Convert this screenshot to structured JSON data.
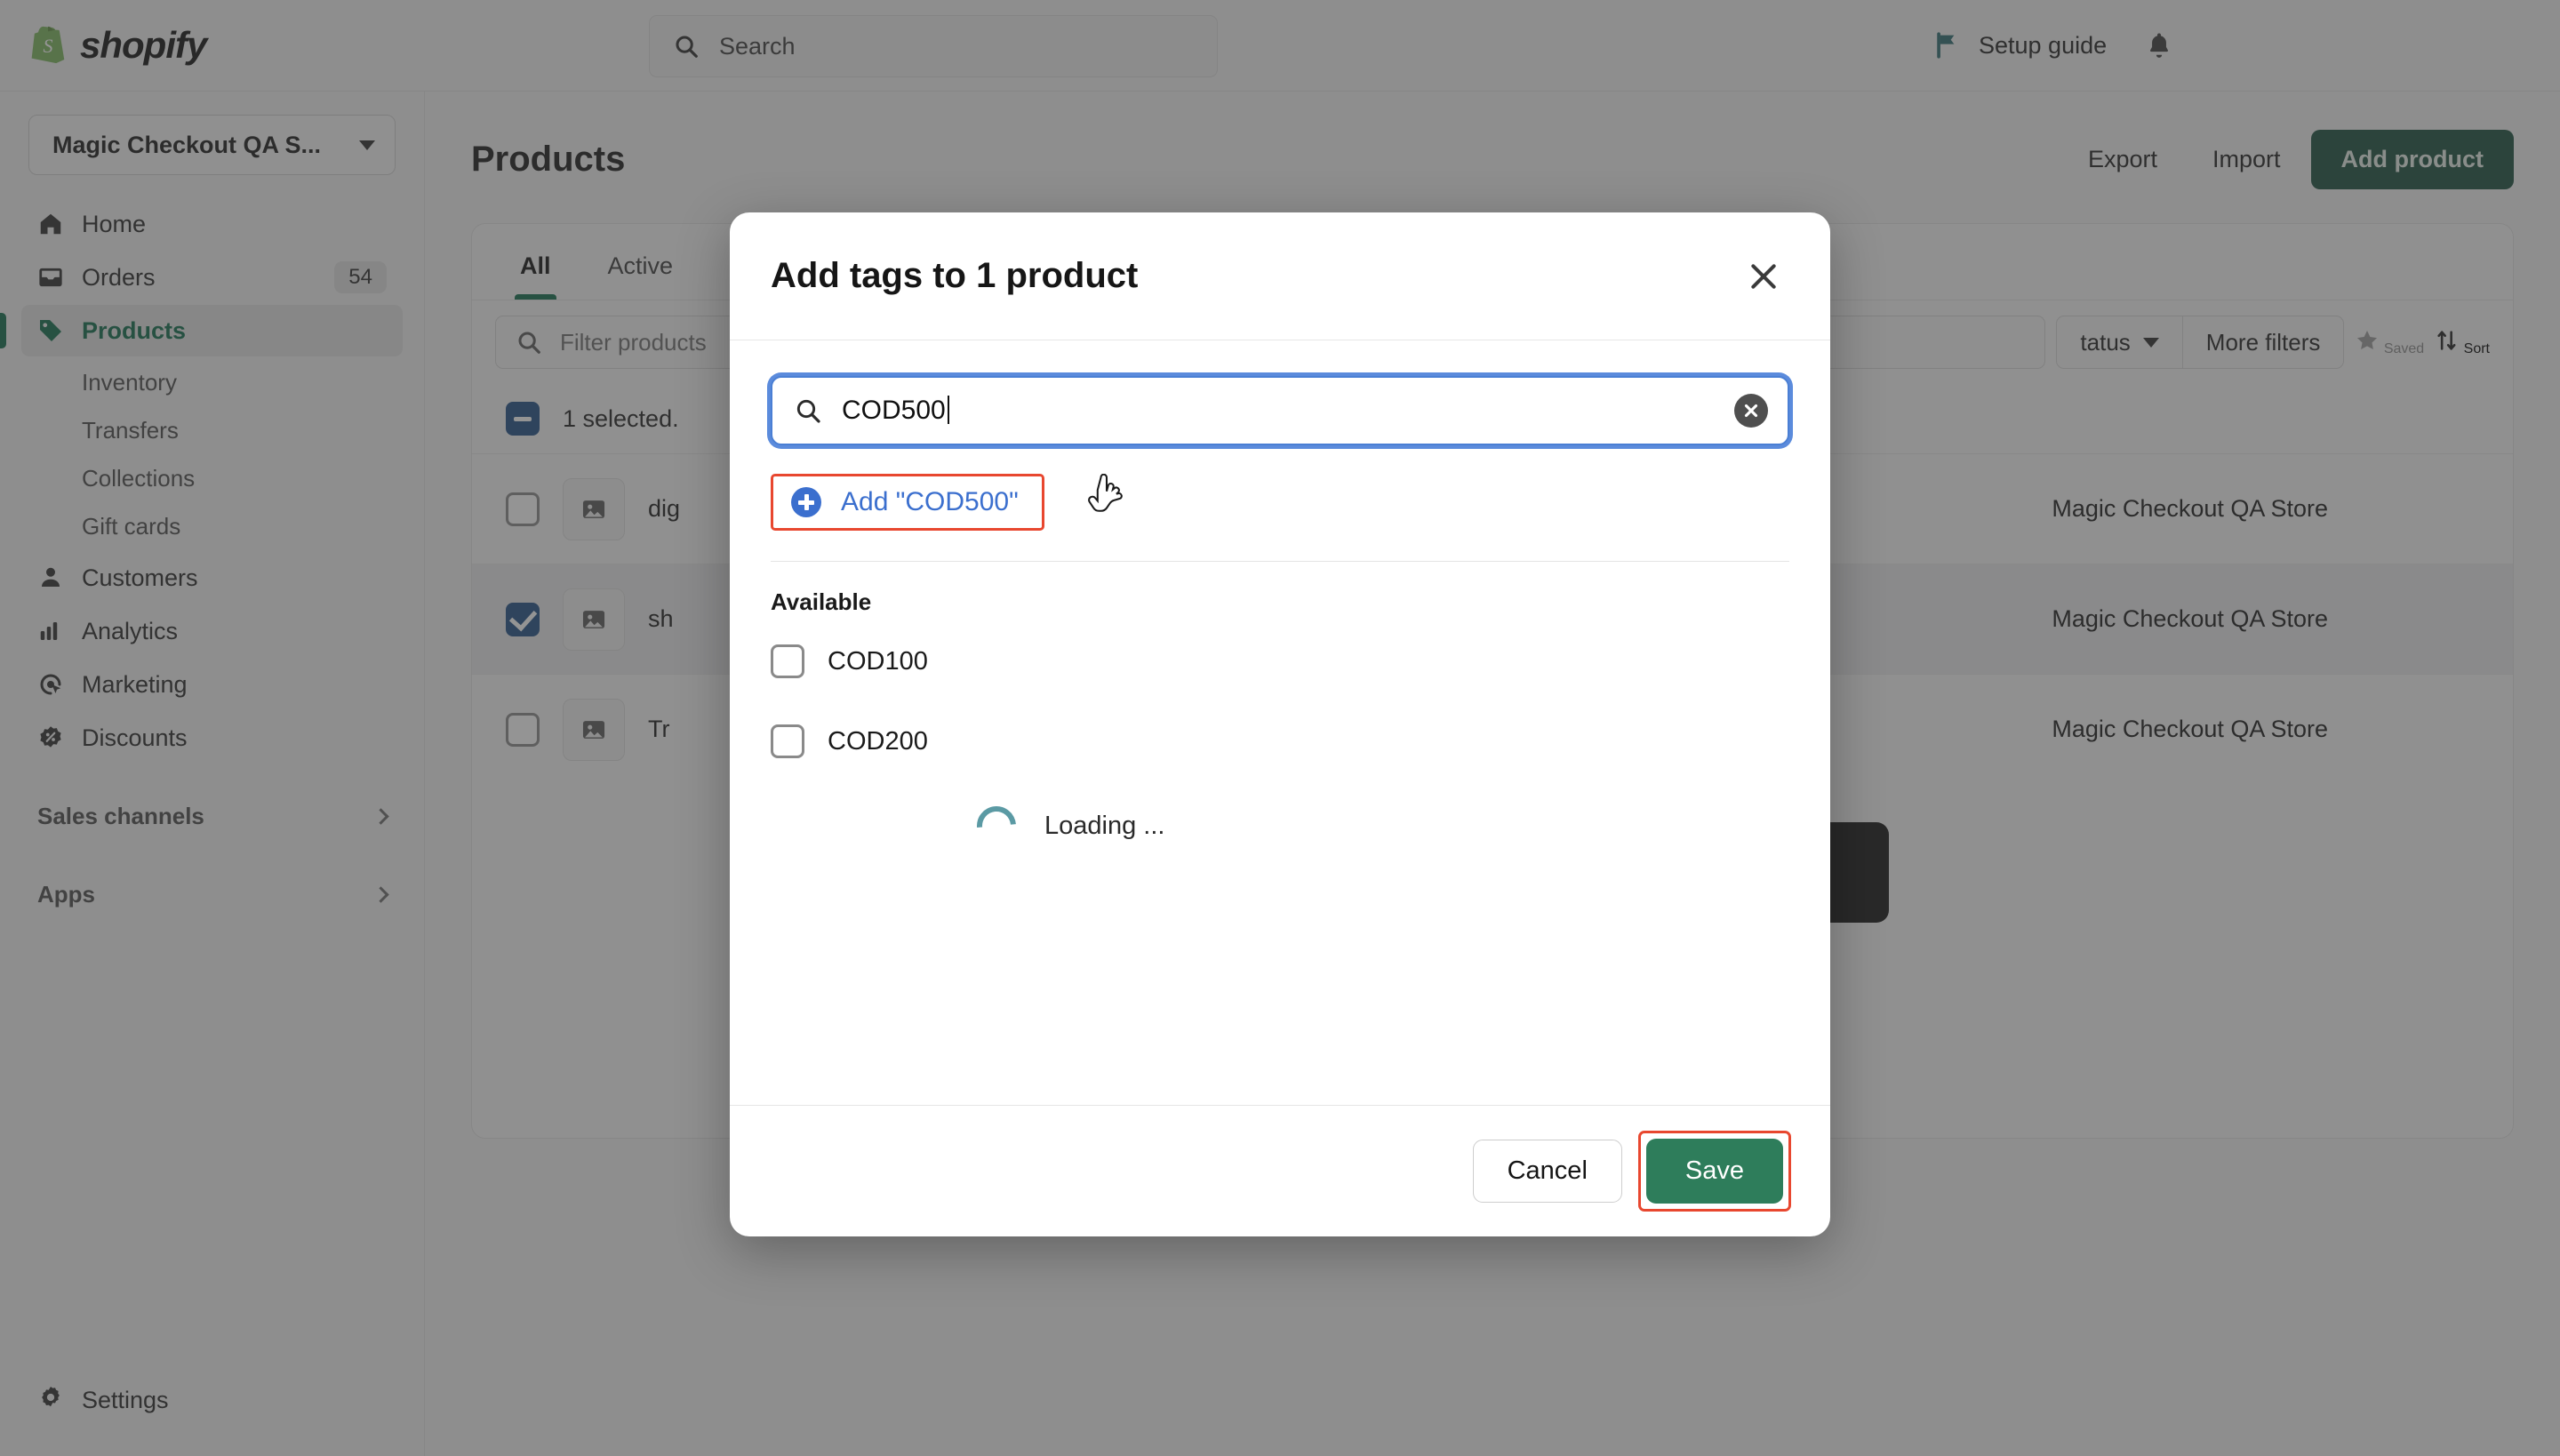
{
  "topbar": {
    "brand": "shopify",
    "search_placeholder": "Search",
    "setup_guide_label": "Setup guide",
    "flag_icon": "flag-icon",
    "bell_icon": "bell-icon",
    "search_icon": "search-icon"
  },
  "sidebar": {
    "store_name": "Magic Checkout QA S...",
    "items": [
      {
        "label": "Home",
        "icon": "home-icon",
        "badge": ""
      },
      {
        "label": "Orders",
        "icon": "orders-inbox-icon",
        "badge": "54"
      },
      {
        "label": "Products",
        "icon": "tag-icon",
        "badge": "",
        "active": true
      },
      {
        "label": "Customers",
        "icon": "person-icon",
        "badge": ""
      },
      {
        "label": "Analytics",
        "icon": "bar-chart-icon",
        "badge": ""
      },
      {
        "label": "Marketing",
        "icon": "marketing-target-icon",
        "badge": ""
      },
      {
        "label": "Discounts",
        "icon": "discount-badge-icon",
        "badge": ""
      }
    ],
    "sub_items": [
      "Inventory",
      "Transfers",
      "Collections",
      "Gift cards"
    ],
    "groups": [
      {
        "label": "Sales channels"
      },
      {
        "label": "Apps"
      }
    ],
    "settings_label": "Settings",
    "settings_icon": "gear-icon"
  },
  "page": {
    "title": "Products",
    "export_label": "Export",
    "import_label": "Import",
    "add_product_label": "Add product"
  },
  "tabs": [
    {
      "label": "All",
      "selected": true
    },
    {
      "label": "Active",
      "selected": false
    }
  ],
  "filters": {
    "placeholder": "Filter products",
    "status_label": "tatus",
    "more_filters_label": "More filters",
    "saved_label": "Saved",
    "sort_label": "Sort",
    "search_icon": "search-icon",
    "star_icon": "star-icon",
    "sort_icon": "sort-arrows-icon"
  },
  "bulk": {
    "selected_text": "1 selected."
  },
  "products": [
    {
      "name": "dig",
      "store": "Magic Checkout QA Store",
      "checked": false
    },
    {
      "name": "sh",
      "store": "Magic Checkout QA Store",
      "checked": true
    },
    {
      "name": "Tr",
      "store": "Magic Checkout QA Store",
      "checked": false
    }
  ],
  "modal": {
    "title": "Add tags to 1 product",
    "close_icon": "close-icon",
    "search_value": "COD500",
    "search_icon": "search-icon",
    "clear_icon": "clear-circle-icon",
    "add_tag_label": "Add \"COD500\"",
    "plus_icon": "plus-circle-icon",
    "available_label": "Available",
    "available_tags": [
      {
        "label": "COD100",
        "checked": false
      },
      {
        "label": "COD200",
        "checked": false
      }
    ],
    "loading_text": "Loading ...",
    "spinner_icon": "spinner-icon",
    "cancel_label": "Cancel",
    "save_label": "Save"
  },
  "colors": {
    "brand_green": "#0f6b4b",
    "primary_button": "#1a4f3d",
    "save_button": "#2e7d5b",
    "highlight_red": "#e8472f",
    "link_blue": "#3b6fce",
    "focus_blue": "#5b8bdc",
    "checkbox_blue": "#1f4e85",
    "spinner_teal": "#5b9aa4"
  }
}
